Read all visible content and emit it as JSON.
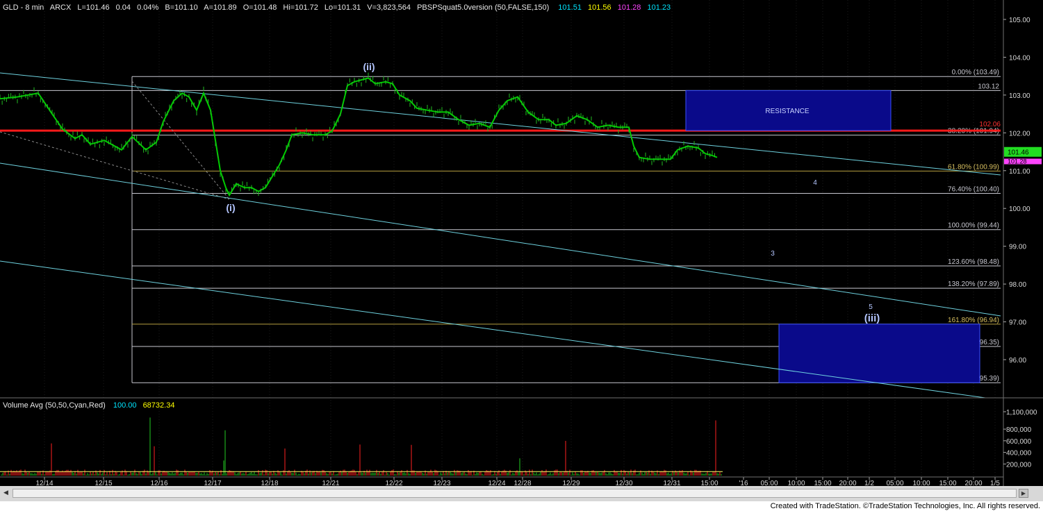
{
  "header": {
    "symbol": "GLD - 8 min",
    "exchange": "ARCX",
    "last": "L=101.46",
    "change": "0.04",
    "change_pct": "0.04%",
    "bid": "B=101.10",
    "ask": "A=101.89",
    "open": "O=101.48",
    "high": "Hi=101.72",
    "low": "Lo=101.31",
    "volume": "V=3,823,564",
    "indicator": "PBSPSquat5.0version (50,FALSE,150)",
    "ind_values": [
      "101.51",
      "101.56",
      "101.28",
      "101.23"
    ],
    "ind_colors": [
      "#00e5ff",
      "#ffff00",
      "#ff44ff",
      "#00e5ff"
    ]
  },
  "volume_header": {
    "label": "Volume Avg (50,50,Cyan,Red)",
    "v1": "100.00",
    "v2": "68732.34"
  },
  "price_labels": {
    "current": "101.46",
    "current2": "101.28",
    "resistance_line": "102.06"
  },
  "annotations": {
    "wave_i": "(i)",
    "wave_ii": "(ii)",
    "wave_iii": "(iii)",
    "sub_3": "3",
    "sub_4": "4",
    "sub_5": "5",
    "resistance": "RESISTANCE"
  },
  "colors": {
    "background": "#000000",
    "price_up": "#00cc00",
    "resistance_line": "#ff1a1a",
    "channel": "#6fd3e0",
    "fib_line": "#c8c8d0",
    "fib_gold": "#b8a040",
    "zone_fill": "#0a0a8a"
  },
  "scrollbar": {
    "left_arrow": "◀",
    "right_arrow": "▶"
  },
  "footer": {
    "credits": "Created with TradeStation. ©TradeStation Technologies, Inc. All rights reserved."
  },
  "chart_data": [
    {
      "type": "line",
      "title": "GLD - 8 min",
      "x_ticks": [
        "12/14",
        "12/15",
        "12/16",
        "12/17",
        "12/18",
        "12/21",
        "12/22",
        "12/23",
        "12/24",
        "12/28",
        "12/29",
        "12/30",
        "12/31",
        "15:00",
        "'16",
        "05:00",
        "10:00",
        "15:00",
        "20:00",
        "1/2",
        "05:00",
        "10:00",
        "15:00",
        "20:00",
        "1/5"
      ],
      "y_ticks": [
        "105.00",
        "104.00",
        "103.00",
        "102.00",
        "101.00",
        "100.00",
        "99.00",
        "98.00",
        "97.00",
        "96.00"
      ],
      "ylim": [
        95.0,
        105.3
      ],
      "series": [
        {
          "values": [
            [
              0,
              102.9
            ],
            [
              25,
              102.95
            ],
            [
              55,
              103.05
            ],
            [
              75,
              102.5
            ],
            [
              90,
              102.1
            ],
            [
              108,
              101.85
            ],
            [
              118,
              101.95
            ],
            [
              130,
              101.7
            ],
            [
              150,
              101.8
            ],
            [
              175,
              101.55
            ],
            [
              190,
              101.9
            ],
            [
              210,
              101.55
            ],
            [
              225,
              101.75
            ],
            [
              235,
              102.3
            ],
            [
              250,
              102.85
            ],
            [
              262,
              103.05
            ],
            [
              272,
              102.95
            ],
            [
              283,
              102.6
            ],
            [
              293,
              103.05
            ],
            [
              303,
              102.6
            ],
            [
              310,
              101.8
            ],
            [
              317,
              101.0
            ],
            [
              325,
              100.55
            ],
            [
              330,
              100.35
            ],
            [
              340,
              100.65
            ],
            [
              352,
              100.55
            ],
            [
              362,
              100.55
            ],
            [
              372,
              100.45
            ],
            [
              382,
              100.55
            ],
            [
              392,
              100.85
            ],
            [
              402,
              101.15
            ],
            [
              412,
              101.55
            ],
            [
              420,
              101.95
            ],
            [
              435,
              102.0
            ],
            [
              450,
              101.95
            ],
            [
              468,
              101.95
            ],
            [
              478,
              102.05
            ],
            [
              490,
              102.5
            ],
            [
              500,
              103.25
            ],
            [
              510,
              103.35
            ],
            [
              520,
              103.4
            ],
            [
              530,
              103.45
            ],
            [
              540,
              103.3
            ],
            [
              555,
              103.35
            ],
            [
              565,
              103.3
            ],
            [
              575,
              103.0
            ],
            [
              590,
              102.85
            ],
            [
              600,
              102.65
            ],
            [
              615,
              102.6
            ],
            [
              630,
              102.55
            ],
            [
              645,
              102.55
            ],
            [
              660,
              102.35
            ],
            [
              675,
              102.2
            ],
            [
              690,
              102.25
            ],
            [
              705,
              102.15
            ],
            [
              718,
              102.6
            ],
            [
              730,
              102.85
            ],
            [
              745,
              102.95
            ],
            [
              760,
              102.55
            ],
            [
              775,
              102.35
            ],
            [
              790,
              102.35
            ],
            [
              800,
              102.2
            ],
            [
              815,
              102.25
            ],
            [
              830,
              102.45
            ],
            [
              845,
              102.35
            ],
            [
              860,
              102.15
            ],
            [
              875,
              102.2
            ],
            [
              890,
              102.15
            ],
            [
              905,
              102.15
            ],
            [
              912,
              101.65
            ],
            [
              920,
              101.35
            ],
            [
              935,
              101.3
            ],
            [
              950,
              101.3
            ],
            [
              965,
              101.3
            ],
            [
              975,
              101.55
            ],
            [
              990,
              101.65
            ],
            [
              1005,
              101.6
            ],
            [
              1015,
              101.45
            ],
            [
              1025,
              101.4
            ],
            [
              1032,
              101.35
            ]
          ]
        }
      ],
      "horizontal_levels": [
        {
          "label": "0.00% (103.49)",
          "value": 103.49
        },
        {
          "label": "103.12",
          "value": 103.12
        },
        {
          "label": "38.20% (101.94)",
          "value": 101.94
        },
        {
          "label": "61.80% (100.99)",
          "value": 100.99
        },
        {
          "label": "76.40% (100.40)",
          "value": 100.4
        },
        {
          "label": "100.00% (99.44)",
          "value": 99.44
        },
        {
          "label": "123.60% (98.48)",
          "value": 98.48
        },
        {
          "label": "138.20% (97.89)",
          "value": 97.89
        },
        {
          "label": "161.80% (96.94)",
          "value": 96.94
        },
        {
          "label": "176.40% (96.35)",
          "value": 96.35
        },
        {
          "label": "200.00% (95.39)",
          "value": 95.39
        }
      ],
      "resistance_level": 102.06,
      "resistance_zone": [
        102.06,
        103.12
      ],
      "target_zone": [
        95.39,
        96.94
      ]
    },
    {
      "type": "bar",
      "title": "Volume Avg (50,50,Cyan,Red)",
      "y_ticks": [
        "1,100,000",
        "800,000",
        "600,000",
        "400,000",
        "200,000"
      ],
      "ylim": [
        0,
        1150000
      ],
      "baseline_avg": 68732.34
    }
  ]
}
